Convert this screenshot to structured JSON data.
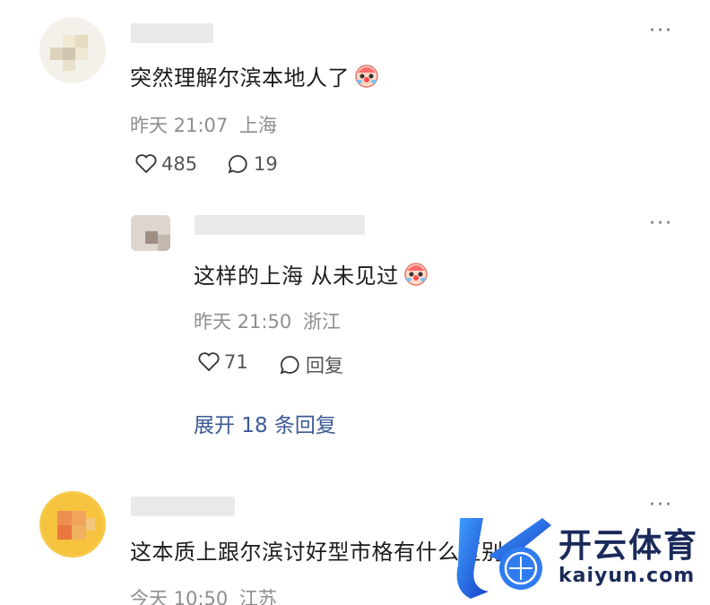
{
  "comments": [
    {
      "text": "突然理解尔滨本地人了",
      "time": "昨天 21:07",
      "location": "上海",
      "likes": "485",
      "replies_count": "19",
      "more": "···"
    },
    {
      "text": "这样的上海 从未见过",
      "time": "昨天 21:50",
      "location": "浙江",
      "likes": "71",
      "reply_label": "回复",
      "more": "···"
    },
    {
      "text": "这本质上跟尔滨讨好型市格有什么区别",
      "time": "今天 10:50",
      "location": "江苏",
      "more": "···"
    }
  ],
  "expand_label": "展开 18 条回复",
  "watermark": {
    "title": "开云体育",
    "url": "kaiyun.com"
  },
  "colors": {
    "link": "#3b5a96",
    "meta": "#8e8e93",
    "placeholder": "#e9e9ec"
  },
  "icons": [
    "heart-icon",
    "comment-icon",
    "more-icon",
    "clown-emoji-icon"
  ]
}
